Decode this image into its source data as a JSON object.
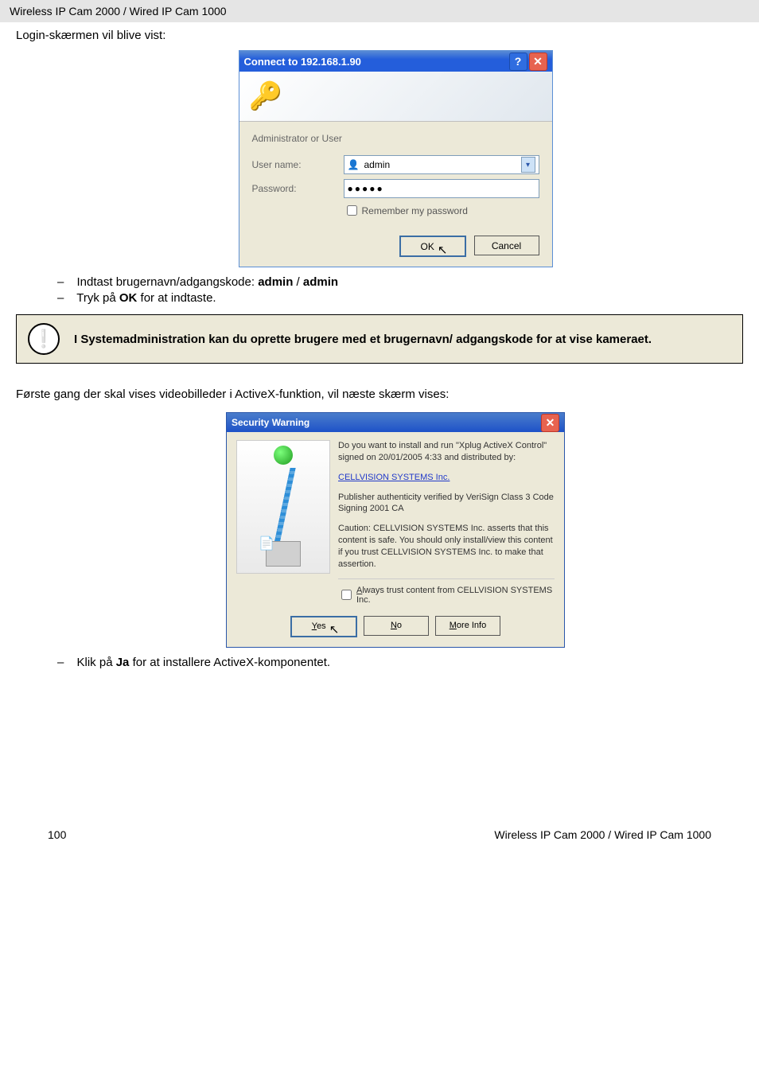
{
  "header": {
    "title": "Wireless IP Cam 2000 / Wired IP Cam 1000"
  },
  "intro": "Login-skærmen vil blive vist:",
  "connect": {
    "title": "Connect to 192.168.1.90",
    "help_glyph": "?",
    "close_glyph": "✕",
    "heading": "Administrator or User",
    "user_label": "User name:",
    "user_value": "admin",
    "pass_label": "Password:",
    "pass_value": "●●●●●",
    "remember_label": "Remember my password",
    "ok": "OK",
    "cancel": "Cancel"
  },
  "bullets1": [
    {
      "pre": "Indtast brugernavn/adgangskode: ",
      "b1": "admin",
      "mid": " / ",
      "b2": "admin"
    },
    {
      "pre": "Tryk på ",
      "b1": "OK",
      "post": " for at indtaste."
    }
  ],
  "note": {
    "icon": "❕",
    "text": "I Systemadministration kan du oprette brugere med et brugernavn/ adgangskode for at vise kameraet."
  },
  "para2": "Første gang der skal vises videobilleder i ActiveX-funktion, vil næste skærm vises:",
  "security": {
    "title": "Security Warning",
    "close_glyph": "✕",
    "q": "Do you want to install and run \"Xplug ActiveX Control\" signed on 20/01/2005 4:33 and distributed by:",
    "link": "CELLVISION SYSTEMS Inc.",
    "verified": "Publisher authenticity verified by VeriSign Class 3 Code Signing 2001 CA",
    "caution": "Caution: CELLVISION SYSTEMS Inc. asserts that this content is safe.  You should only install/view this content if you trust CELLVISION SYSTEMS Inc. to make that assertion.",
    "always_prefix_u": "A",
    "always_rest": "lways trust content from CELLVISION SYSTEMS Inc.",
    "yes_u": "Y",
    "yes_rest": "es",
    "no_u": "N",
    "no_rest": "o",
    "more_u": "M",
    "more_rest": "ore Info"
  },
  "bullets2": [
    {
      "pre": "Klik på ",
      "b1": "Ja",
      "post": " for at installere ActiveX-komponentet."
    }
  ],
  "footer": {
    "page": "100",
    "right": "Wireless IP Cam 2000 / Wired IP Cam 1000"
  }
}
